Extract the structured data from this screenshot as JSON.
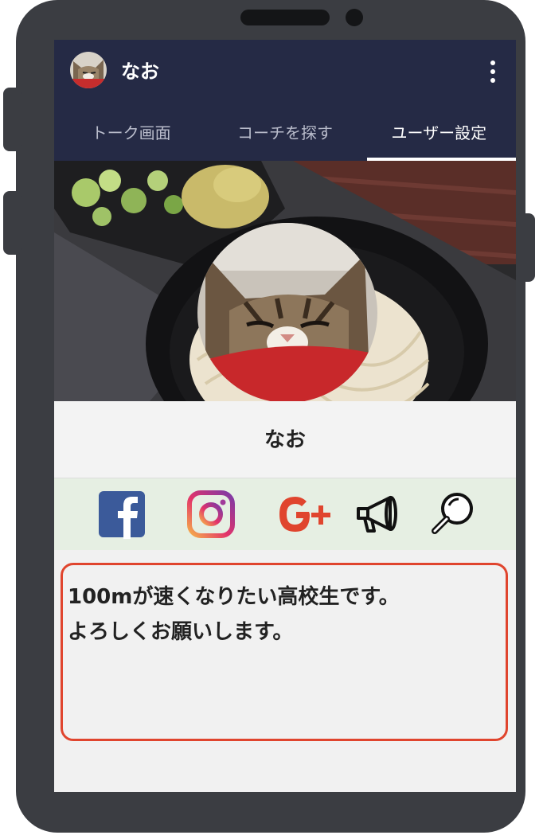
{
  "app": {
    "username": "なお",
    "menu_icon": "kebab-menu-icon"
  },
  "tabs": [
    {
      "label": "トーク画面",
      "active": false
    },
    {
      "label": "コーチを探す",
      "active": false
    },
    {
      "label": "ユーザー設定",
      "active": true
    }
  ],
  "profile": {
    "name": "なお",
    "bio": [
      "100mが速くなりたい高校生です。",
      "よろしくお願いします。"
    ]
  },
  "social_icons": [
    "facebook-icon",
    "instagram-icon",
    "google-plus-icon",
    "megaphone-icon",
    "magnifier-icon"
  ],
  "colors": {
    "header_bg": "#252a45",
    "bio_border": "#e0452e",
    "social_bg": "#e6efe3"
  }
}
